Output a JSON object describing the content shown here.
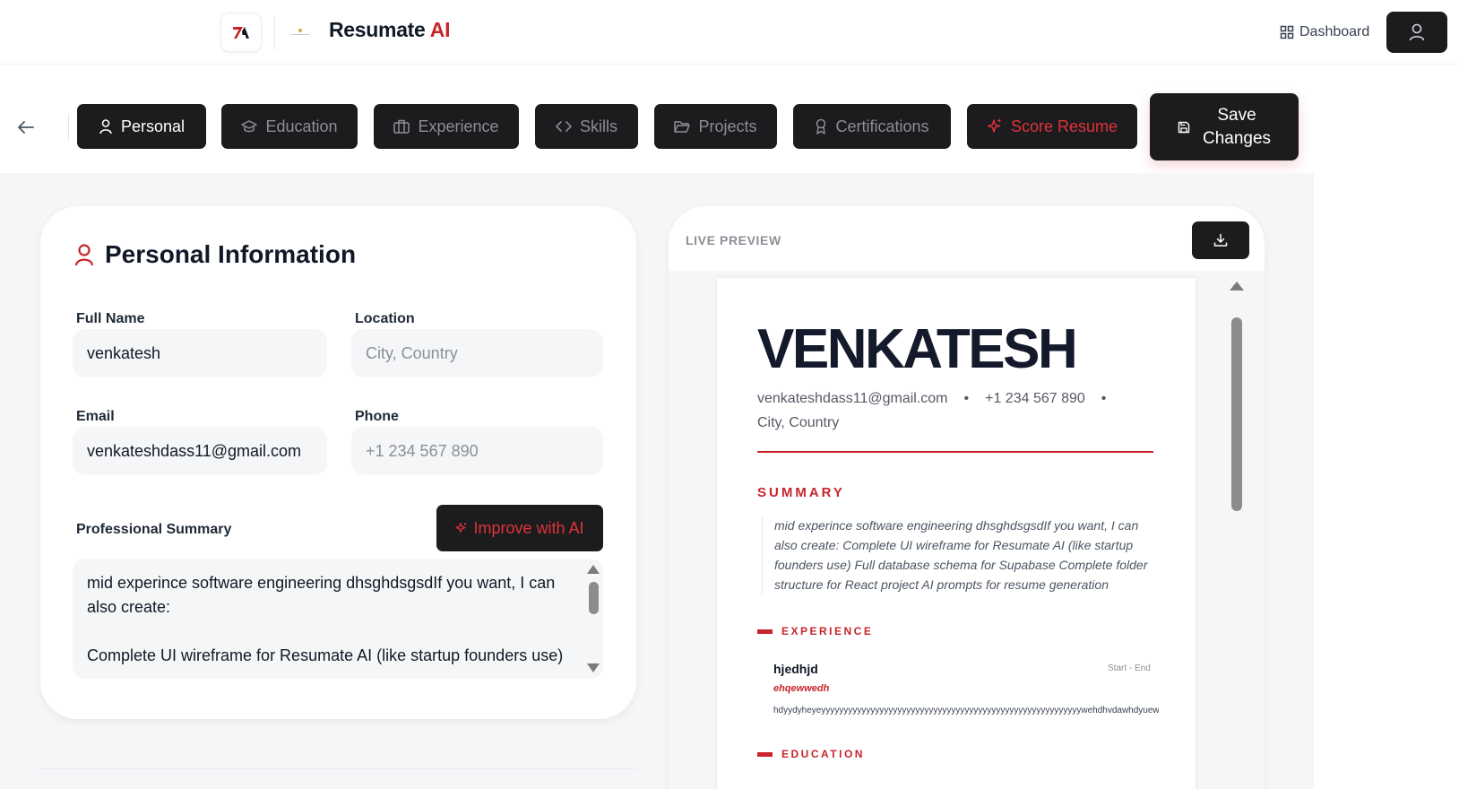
{
  "header": {
    "brand_main": "Resumate",
    "brand_accent": "AI",
    "dashboard_label": "Dashboard"
  },
  "tabs": [
    {
      "label": "Personal",
      "icon": "user-icon",
      "active": true
    },
    {
      "label": "Education",
      "icon": "graduation-cap-icon"
    },
    {
      "label": "Experience",
      "icon": "briefcase-icon"
    },
    {
      "label": "Skills",
      "icon": "code-icon"
    },
    {
      "label": "Projects",
      "icon": "folder-icon"
    },
    {
      "label": "Certifications",
      "icon": "award-icon"
    },
    {
      "label": "Score Resume",
      "icon": "sparkles-icon"
    }
  ],
  "save_button": {
    "line1": "Save",
    "line2": "Changes"
  },
  "form": {
    "title": "Personal Information",
    "full_name": {
      "label": "Full Name",
      "value": "venkatesh"
    },
    "location": {
      "label": "Location",
      "placeholder": "City, Country"
    },
    "email": {
      "label": "Email",
      "value": "venkateshdass11@gmail.com"
    },
    "phone": {
      "label": "Phone",
      "placeholder": "+1 234 567 890"
    },
    "summary": {
      "label": "Professional Summary",
      "improve_label": "Improve with AI",
      "value": "mid experince software engineering dhsghdsgsdIf you want, I can also create:\n\nComplete UI wireframe for Resumate AI (like startup founders use)"
    }
  },
  "preview": {
    "label": "LIVE PREVIEW",
    "name": "VENKATESH",
    "email": "venkateshdass11@gmail.com",
    "phone": "+1 234 567 890",
    "location": "City, Country",
    "summary_heading": "SUMMARY",
    "summary_text": "mid experince software engineering dhsghdsgsdIf you want, I can also create: Complete UI wireframe for Resumate AI (like startup founders use) Full database schema for Supabase Complete folder structure for React project AI prompts for resume generation",
    "experience_heading": "EXPERIENCE",
    "job_title": "hjedhjd",
    "job_dates": "Start - End",
    "company": "ehqewwedh",
    "job_desc": "hdyydyheyeyyyyyyyyyyyyyyyyyyyyyyyyyyyyyyyyyyyyyyyyyyyyyyyyyyyyyyyyyywehdhvdawhdyuewrhr",
    "education_heading": "EDUCATION"
  },
  "colors": {
    "accent": "#c8242c",
    "dark": "#1c1c1e",
    "tab_inactive": "#8e8e93"
  }
}
